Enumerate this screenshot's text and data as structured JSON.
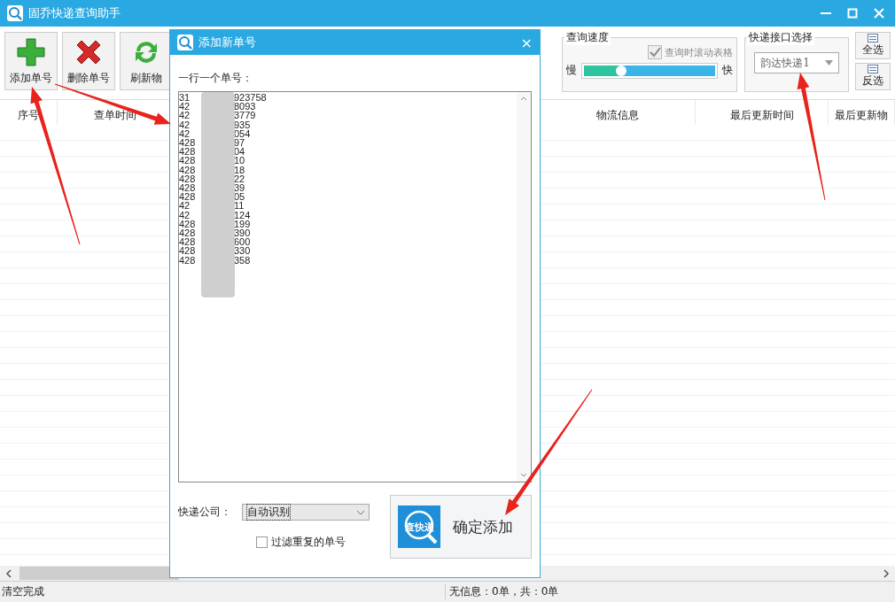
{
  "window": {
    "title": "固乔快递查询助手"
  },
  "toolbar": {
    "buttons": [
      {
        "label": "添加单号",
        "kind": "add"
      },
      {
        "label": "删除单号",
        "kind": "delete"
      },
      {
        "label": "刷新物",
        "kind": "refresh"
      }
    ]
  },
  "speed_group": {
    "title": "查询速度",
    "scroll_checkbox": {
      "label": "查询时滚动表格",
      "checked": true,
      "disabled": true
    },
    "slow_label": "慢",
    "fast_label": "快",
    "slider": {
      "level": 0.28
    }
  },
  "api_group": {
    "title": "快递接口选择",
    "select": {
      "value": "韵达快递1"
    }
  },
  "side_buttons": [
    {
      "label": "全选"
    },
    {
      "label": "反选"
    }
  ],
  "table": {
    "columns": [
      {
        "label": "序号"
      },
      {
        "label": "查单时间"
      },
      {
        "label": "物流信息"
      },
      {
        "label": "最后更新时间"
      },
      {
        "label": "最后更新物"
      }
    ]
  },
  "status_bar": {
    "left": "清空完成",
    "right": "无信息：0单，共：0单"
  },
  "dialog": {
    "title": "添加新单号",
    "close": "×",
    "prompt": "一行一个单号：",
    "lines": [
      {
        "start": "31",
        "end": "923758"
      },
      {
        "start": "42",
        "end": "8093"
      },
      {
        "start": "42",
        "end": "3779"
      },
      {
        "start": "42",
        "end": "935"
      },
      {
        "start": "42",
        "end": "054"
      },
      {
        "start": "428",
        "end": "97"
      },
      {
        "start": "428",
        "end": "04"
      },
      {
        "start": "428",
        "end": "10"
      },
      {
        "start": "428",
        "end": "18"
      },
      {
        "start": "428",
        "end": "22"
      },
      {
        "start": "428",
        "end": "39"
      },
      {
        "start": "428",
        "end": "05"
      },
      {
        "start": "42",
        "end": "11"
      },
      {
        "start": "42",
        "end": "124"
      },
      {
        "start": "428",
        "end": "199"
      },
      {
        "start": "428",
        "end": "390"
      },
      {
        "start": "428",
        "end": "600"
      },
      {
        "start": "428",
        "end": "330"
      },
      {
        "start": "428",
        "end": "358"
      }
    ],
    "company_label": "快递公司：",
    "company_select": {
      "value": "自动识别"
    },
    "filter_checkbox": {
      "label": "过滤重复的单号",
      "checked": false
    },
    "confirm_button": {
      "icon_text": "查快递",
      "label": "确定添加"
    }
  }
}
